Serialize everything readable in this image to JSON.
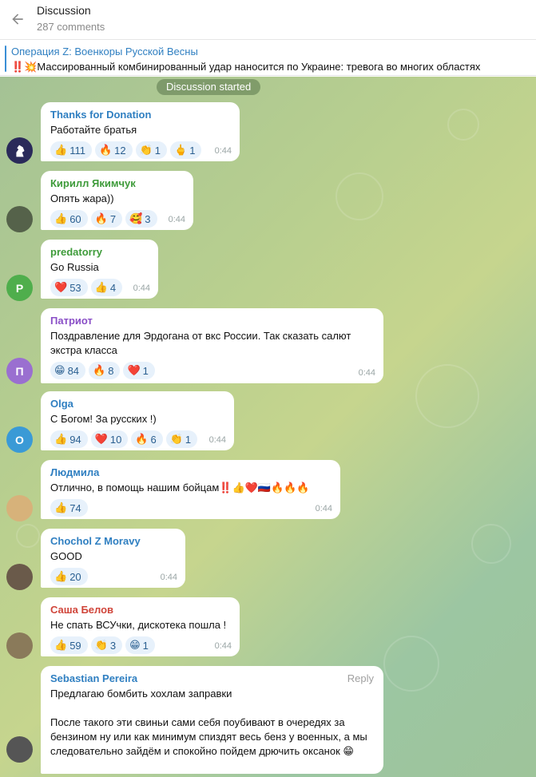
{
  "header": {
    "title": "Discussion",
    "subtitle": "287 comments"
  },
  "pinned": {
    "channel": "Операция Z: Военкоры Русской Весны",
    "text": "‼️💥Массированный комбинированный удар наносится по Украине: тревога во многих областях"
  },
  "system": {
    "discussion_started": "Discussion started"
  },
  "messages": [
    {
      "author": "Thanks for Donation",
      "author_color": "#2f7fc1",
      "text": "Работайте братья",
      "time": "0:44",
      "avatar_color": "#2a2a5a",
      "reactions": [
        {
          "emoji": "👍",
          "count": "111"
        },
        {
          "emoji": "🔥",
          "count": "12"
        },
        {
          "emoji": "👏",
          "count": "1"
        },
        {
          "emoji": "🖕",
          "count": "1"
        }
      ]
    },
    {
      "author": "Кирилл Якимчук",
      "author_color": "#3e9b3a",
      "text": "Опять жара))",
      "time": "0:44",
      "avatar_color": "#55624a",
      "reactions": [
        {
          "emoji": "👍",
          "count": "60"
        },
        {
          "emoji": "🔥",
          "count": "7"
        },
        {
          "emoji": "🥰",
          "count": "3"
        }
      ]
    },
    {
      "author": "predatorry",
      "author_color": "#3e9b3a",
      "text": "Go Russia",
      "time": "0:44",
      "avatar_letter": "P",
      "avatar_color": "#4fae4c",
      "reactions": [
        {
          "emoji": "❤️",
          "count": "53"
        },
        {
          "emoji": "👍",
          "count": "4"
        }
      ]
    },
    {
      "author": "Патриот",
      "author_color": "#8a4fc7",
      "text": "Поздравление для Эрдогана от вкс России. Так сказать салют экстра класса",
      "time": "0:44",
      "avatar_letter": "П",
      "avatar_color": "#9a6fd0",
      "reactions": [
        {
          "emoji": "😁",
          "count": "84"
        },
        {
          "emoji": "🔥",
          "count": "8"
        },
        {
          "emoji": "❤️",
          "count": "1"
        }
      ]
    },
    {
      "author": "Olga",
      "author_color": "#2f7fc1",
      "text": "С Богом! За русских !)",
      "time": "0:44",
      "avatar_letter": "O",
      "avatar_color": "#3a9ad6",
      "reactions": [
        {
          "emoji": "👍",
          "count": "94"
        },
        {
          "emoji": "❤️",
          "count": "10"
        },
        {
          "emoji": "🔥",
          "count": "6"
        },
        {
          "emoji": "👏",
          "count": "1"
        }
      ]
    },
    {
      "author": "Людмила",
      "author_color": "#2f7fc1",
      "text": "Отлично, в помощь нашим бойцам‼️👍❤️🇷🇺🔥🔥🔥",
      "time": "0:44",
      "avatar_color": "#d7b27a",
      "reactions": [
        {
          "emoji": "👍",
          "count": "74"
        }
      ]
    },
    {
      "author": "Chochol Z Moravy",
      "author_color": "#2f7fc1",
      "text": "GOOD",
      "time": "0:44",
      "avatar_color": "#6a5a4a",
      "reactions": [
        {
          "emoji": "👍",
          "count": "20"
        }
      ]
    },
    {
      "author": "Саша Белов",
      "author_color": "#d0453a",
      "text": "Не спать ВСУчки, дискотека пошла !",
      "time": "0:44",
      "avatar_color": "#8a7a5a",
      "reactions": [
        {
          "emoji": "👍",
          "count": "59"
        },
        {
          "emoji": "👏",
          "count": "3"
        },
        {
          "emoji": "😁",
          "count": "1"
        }
      ]
    },
    {
      "author": "Sebastian Pereira",
      "author_color": "#2f7fc1",
      "reply_label": "Reply",
      "text1": "Предлагаю бомбить хохлам заправки",
      "text2": "После такого эти свиньи сами себя поубивают в очередях за бензином ну или как минимум спиздят весь бенз у военных, а мы следовательно зайдём и спокойно пойдем дрючить оксанок 😁",
      "avatar_color": "#555"
    }
  ]
}
